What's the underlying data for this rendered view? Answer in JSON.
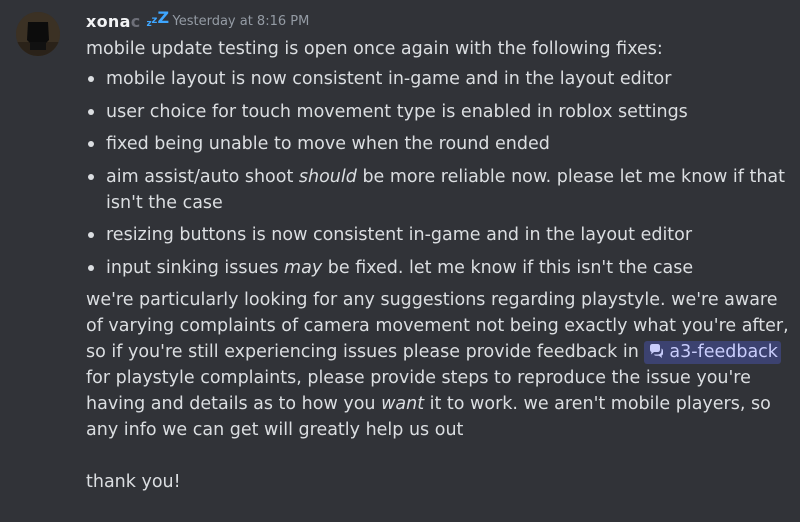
{
  "author": {
    "name_visible": "xona",
    "name_faded": "c",
    "status_icon": "sleep-zzz-icon",
    "timestamp": "Yesterday at 8:16 PM"
  },
  "message": {
    "intro": "mobile update testing is open once again with the following fixes:",
    "fixes": [
      {
        "text": "mobile layout is now consistent in-game and in the layout editor"
      },
      {
        "text": "user choice for touch movement type is enabled in roblox settings"
      },
      {
        "text": "fixed being unable to move when the round ended"
      },
      {
        "before": "aim assist/auto shoot ",
        "emph": "should",
        "after": " be more reliable now. please let me know if that isn't the case"
      },
      {
        "text": "resizing buttons is now consistent in-game and in the layout editor"
      },
      {
        "before": "input sinking issues ",
        "emph": "may",
        "after": " be fixed. let me know if this isn't the case"
      }
    ],
    "para1": "we're particularly looking for any suggestions regarding playstyle. we're aware of varying complaints of camera movement not being exactly what you're after, so if you're still experiencing issues please provide feedback in ",
    "channel_mention": "a3-feedback",
    "para2_before": "for playstyle complaints, please provide steps to reproduce the issue you're having and details as to how you ",
    "para2_emph": "want",
    "para2_after": " it to work. we aren't mobile players, so any info we can get will greatly help us out",
    "closing": "thank you!"
  },
  "colors": {
    "background": "#313338",
    "text": "#dbdee1",
    "timestamp": "#949ba4",
    "mention_bg": "#3c4270",
    "mention_text": "#c9cdfb",
    "status_icon": "#3ea6ff"
  }
}
